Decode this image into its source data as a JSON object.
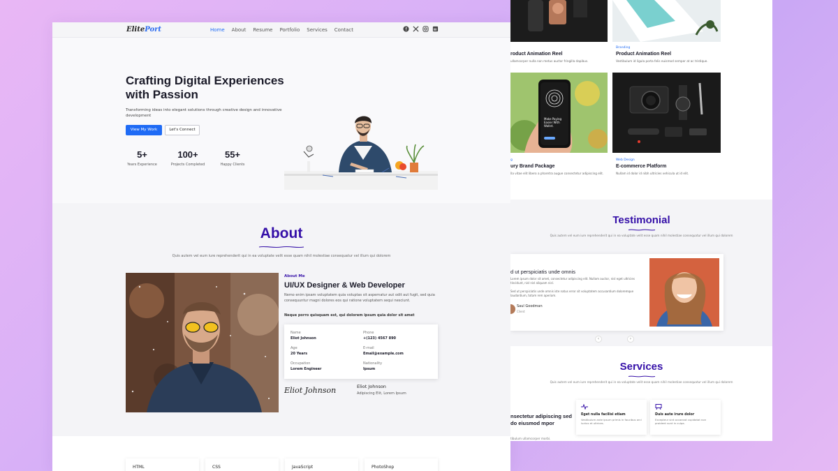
{
  "nav": {
    "logo_a": "Elite",
    "logo_b": "Port",
    "links": [
      "Home",
      "About",
      "Resume",
      "Portfolio",
      "Services",
      "Contact"
    ],
    "icons": [
      "facebook-icon",
      "x-icon",
      "instagram-icon",
      "linkedin-icon"
    ]
  },
  "hero": {
    "title": "Crafting Digital Experiences with Passion",
    "subtitle": "Transforming ideas into elegant solutions through creative design and innovative development",
    "primary_btn": "View My Work",
    "secondary_btn": "Let's Connect",
    "stats": [
      {
        "num": "5+",
        "label": "Years Experience"
      },
      {
        "num": "100+",
        "label": "Projects Completed"
      },
      {
        "num": "55+",
        "label": "Happy Clients"
      }
    ]
  },
  "about": {
    "title": "About",
    "desc": "Quis autem vel eum iure reprehenderit qui in ea voluptate velit esse quam nihil molestiae consequatur vel illum qui dolorem",
    "kicker": "About Me",
    "role": "UI/UX Designer & Web Developer",
    "p1": "Nemo enim ipsam voluptatem quia voluptas sit aspernatur aut odit aut fugit, sed quia consequuntur magni dolores eos qui ratione voluptatem sequi nesciunt.",
    "p2": "Neque porro quisquam est, qui dolorem ipsum quia dolor sit amet",
    "info": [
      {
        "k": "Name",
        "v": "Eliot Johnson"
      },
      {
        "k": "Phone",
        "v": "+(123) 4567 890"
      },
      {
        "k": "Age",
        "v": "20 Years"
      },
      {
        "k": "E-mail",
        "v": "Email@example.com"
      },
      {
        "k": "Occupation",
        "v": "Lorem Engineer"
      },
      {
        "k": "Nationality",
        "v": "Ipsum"
      }
    ],
    "signature": "Eliot Johnson",
    "sig_name": "Eliot Johnson",
    "sig_addr": "Adipiscing Elit, Lorem Ipsum"
  },
  "skills": [
    "HTML",
    "CSS",
    "JavaScript",
    "PhotoShop"
  ],
  "portfolio": [
    {
      "cat": "",
      "title": "roduct Animation Reel",
      "desc": "ullamcorper nulla non metus auctor fringilla dapibus."
    },
    {
      "cat": "Branding",
      "title": "Product Animation Reel",
      "desc": "Vestibulum id ligula porta felis euismod semper at ac tristique."
    },
    {
      "cat": "g",
      "title": "ury Brand Package",
      "desc": "lla vitae elit libero a pharetra augue consectetur adipiscing elit."
    },
    {
      "cat": "Web Design",
      "title": "E-commerce Platform",
      "desc": "Nullam id dolor id nibh ultricies vehicula ut id elit."
    }
  ],
  "phone_screen": "Make Paying Easier With Wallet.",
  "testimonial": {
    "title": "Testimonial",
    "desc": "Quis autem vel eum iure reprehenderit qui in ea voluptate velit esse quam nihil molestiae consequatur vel illum qui dolorem",
    "heading": "d ut perspiciatis unde omnis",
    "p1": "Lorem ipsum dolor sit amet, consectetur adipiscing elit. Nullam auctor, nisl eget ultricies tincidunt, nisl nisl aliquam nisl.",
    "p2": "Sed ut perspiciatis unde omnis iste natus error sit voluptatem accusantium doloremque laudantium, totam rem aperiam.",
    "name": "Saul Goodman",
    "role": "Client"
  },
  "services": {
    "title": "Services",
    "desc": "Quis autem vel eum iure reprehenderit qui in ea voluptate velit esse quam nihil molestiae consequatur vel illum qui dolorem",
    "left_heading": "nsectetur adipiscing sed do eiusmod mpor",
    "left_sub": "tibulum ullamcorper morbi.",
    "cards": [
      {
        "title": "Eget nulla facilisi etiam",
        "desc": "Vestibulum ante ipsum primis in faucibus orci luctus et ultrices."
      },
      {
        "title": "Duis aute irure dolor",
        "desc": "Excepteur sint occaecat cupidatat non proident sunt in culpa."
      }
    ]
  },
  "colors": {
    "accent": "#1f6bf5",
    "brand": "#3510a8"
  }
}
